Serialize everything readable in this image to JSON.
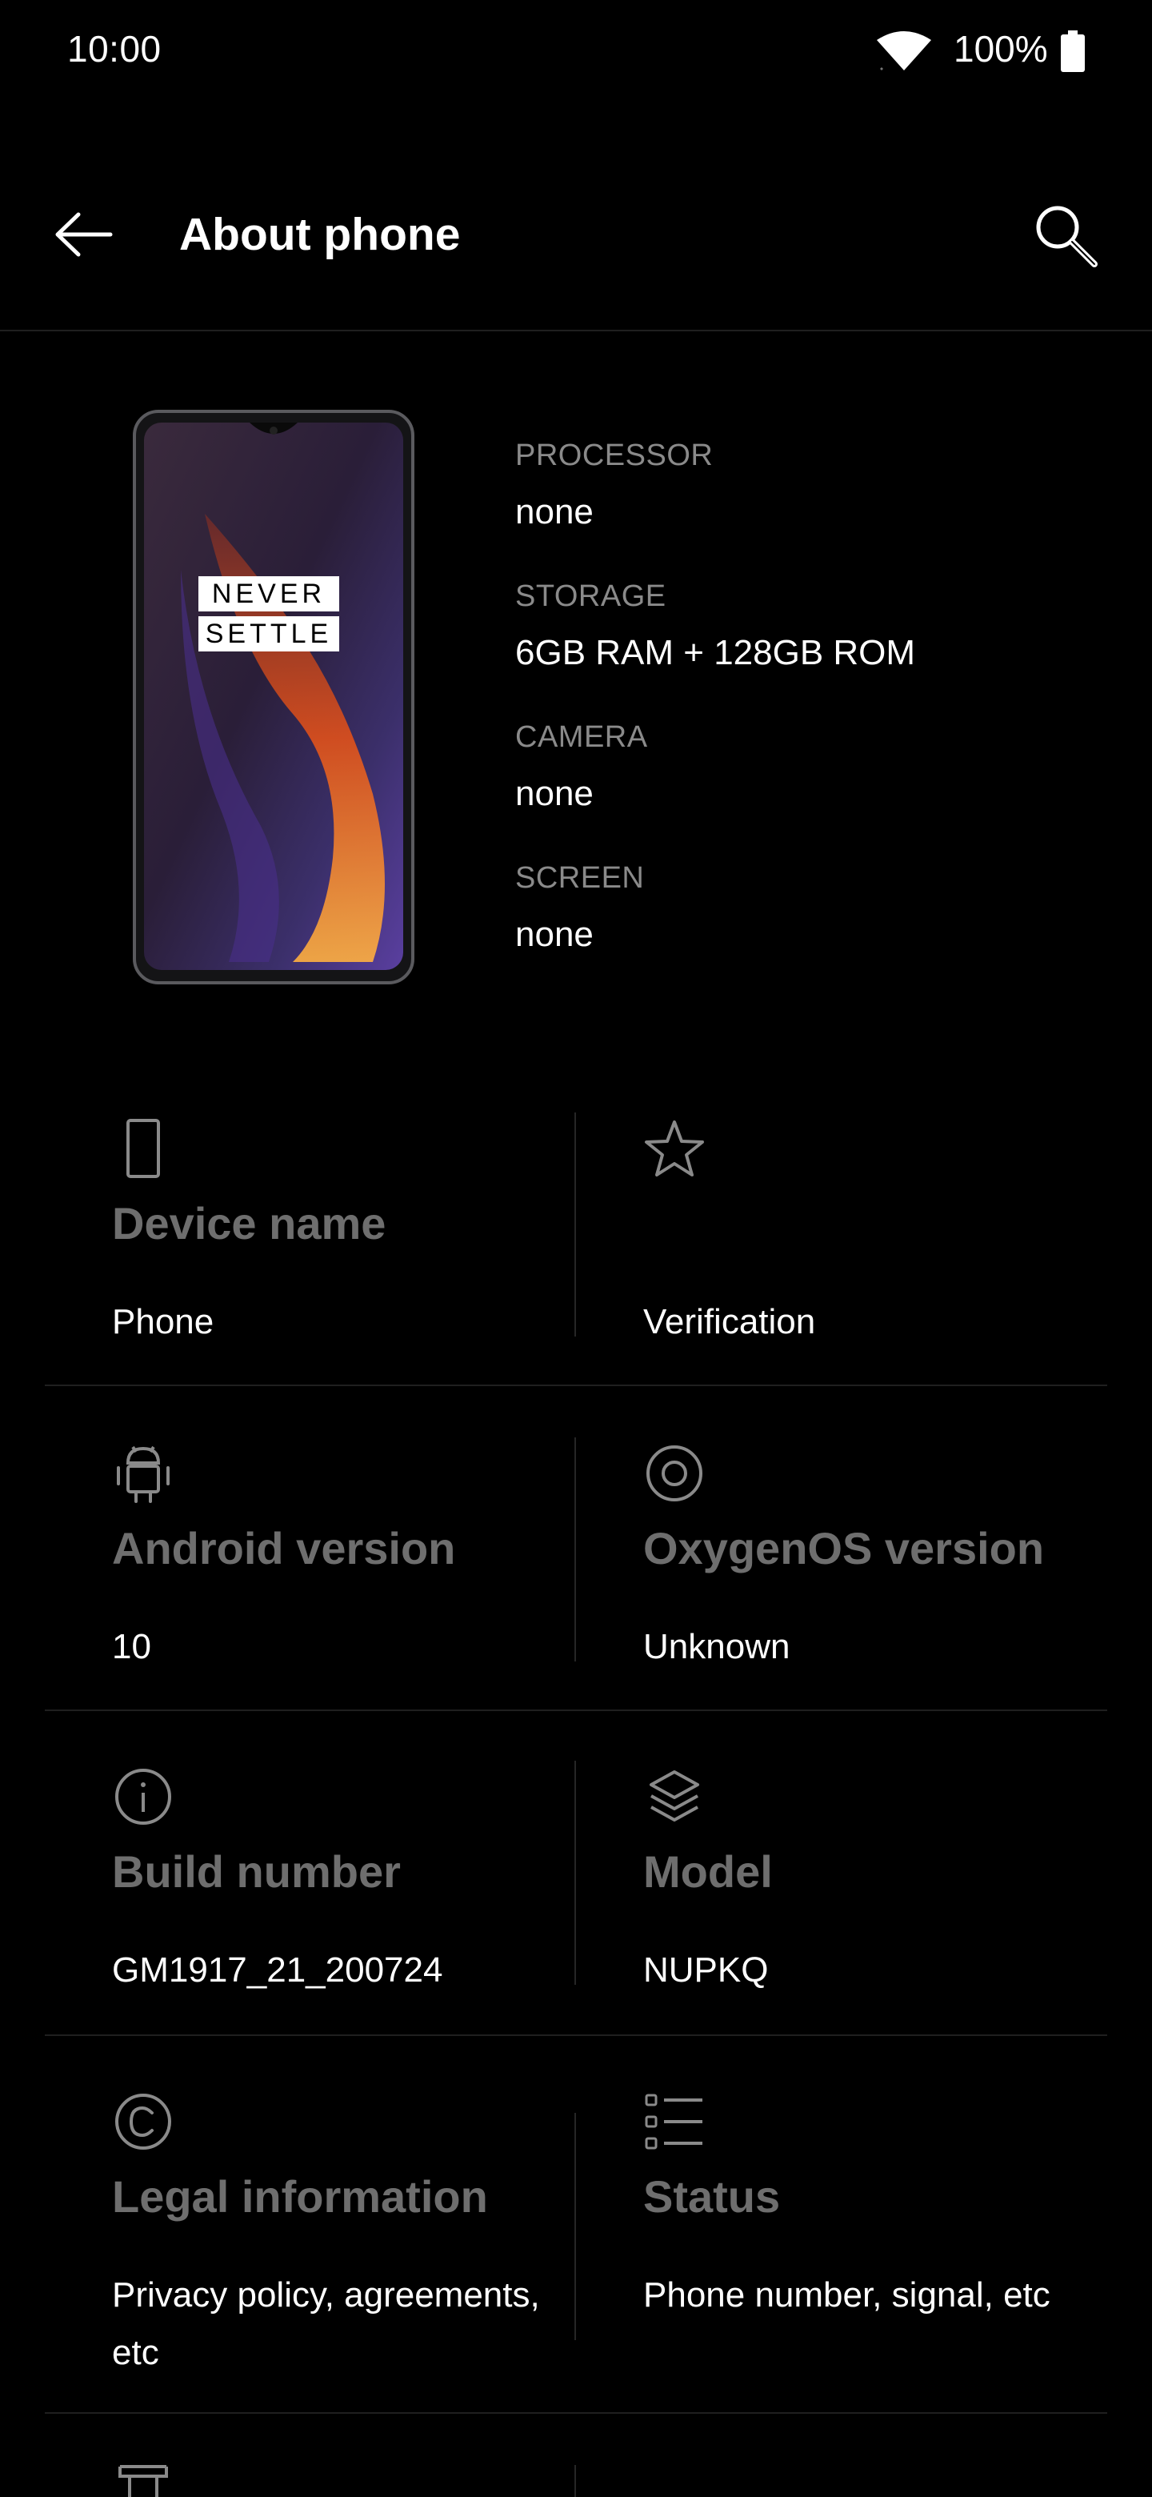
{
  "status_bar": {
    "time": "10:00",
    "battery_percent": "100%",
    "icons": [
      "wifi-icon",
      "battery-icon"
    ]
  },
  "toolbar": {
    "title": "About phone",
    "back_icon": "arrow-left",
    "search_icon": "magnifier"
  },
  "hero": {
    "phone_screen_text": [
      "NEVER",
      "SETTLE"
    ],
    "specs": [
      {
        "label": "PROCESSOR",
        "value": "none"
      },
      {
        "label": "STORAGE",
        "value": "6GB RAM + 128GB ROM"
      },
      {
        "label": "CAMERA",
        "value": "none"
      },
      {
        "label": "SCREEN",
        "value": "none"
      }
    ]
  },
  "tiles": [
    {
      "icon": "phone-outline-icon",
      "title": "Device name",
      "value": "Phone"
    },
    {
      "icon": "star-icon",
      "title": "",
      "value": "Verification"
    },
    {
      "icon": "android-icon",
      "title": "Android version",
      "value": "10"
    },
    {
      "icon": "oxygenos-icon",
      "title": "OxygenOS version",
      "value": "Unknown"
    },
    {
      "icon": "info-icon",
      "title": "Build number",
      "value": "GM1917_21_200724"
    },
    {
      "icon": "layers-icon",
      "title": "Model",
      "value": "NUPKQ"
    },
    {
      "icon": "copyright-icon",
      "title": "Legal information",
      "value": "Privacy policy, agreements, etc"
    },
    {
      "icon": "list-icon",
      "title": "Status",
      "value": "Phone number, signal, etc"
    }
  ],
  "colors": {
    "background": "#000000",
    "primary_text": "#ffffff",
    "secondary_text": "#8a8a8a",
    "tile_title": "#6e6e6e",
    "divider": "#1f1f1f"
  }
}
